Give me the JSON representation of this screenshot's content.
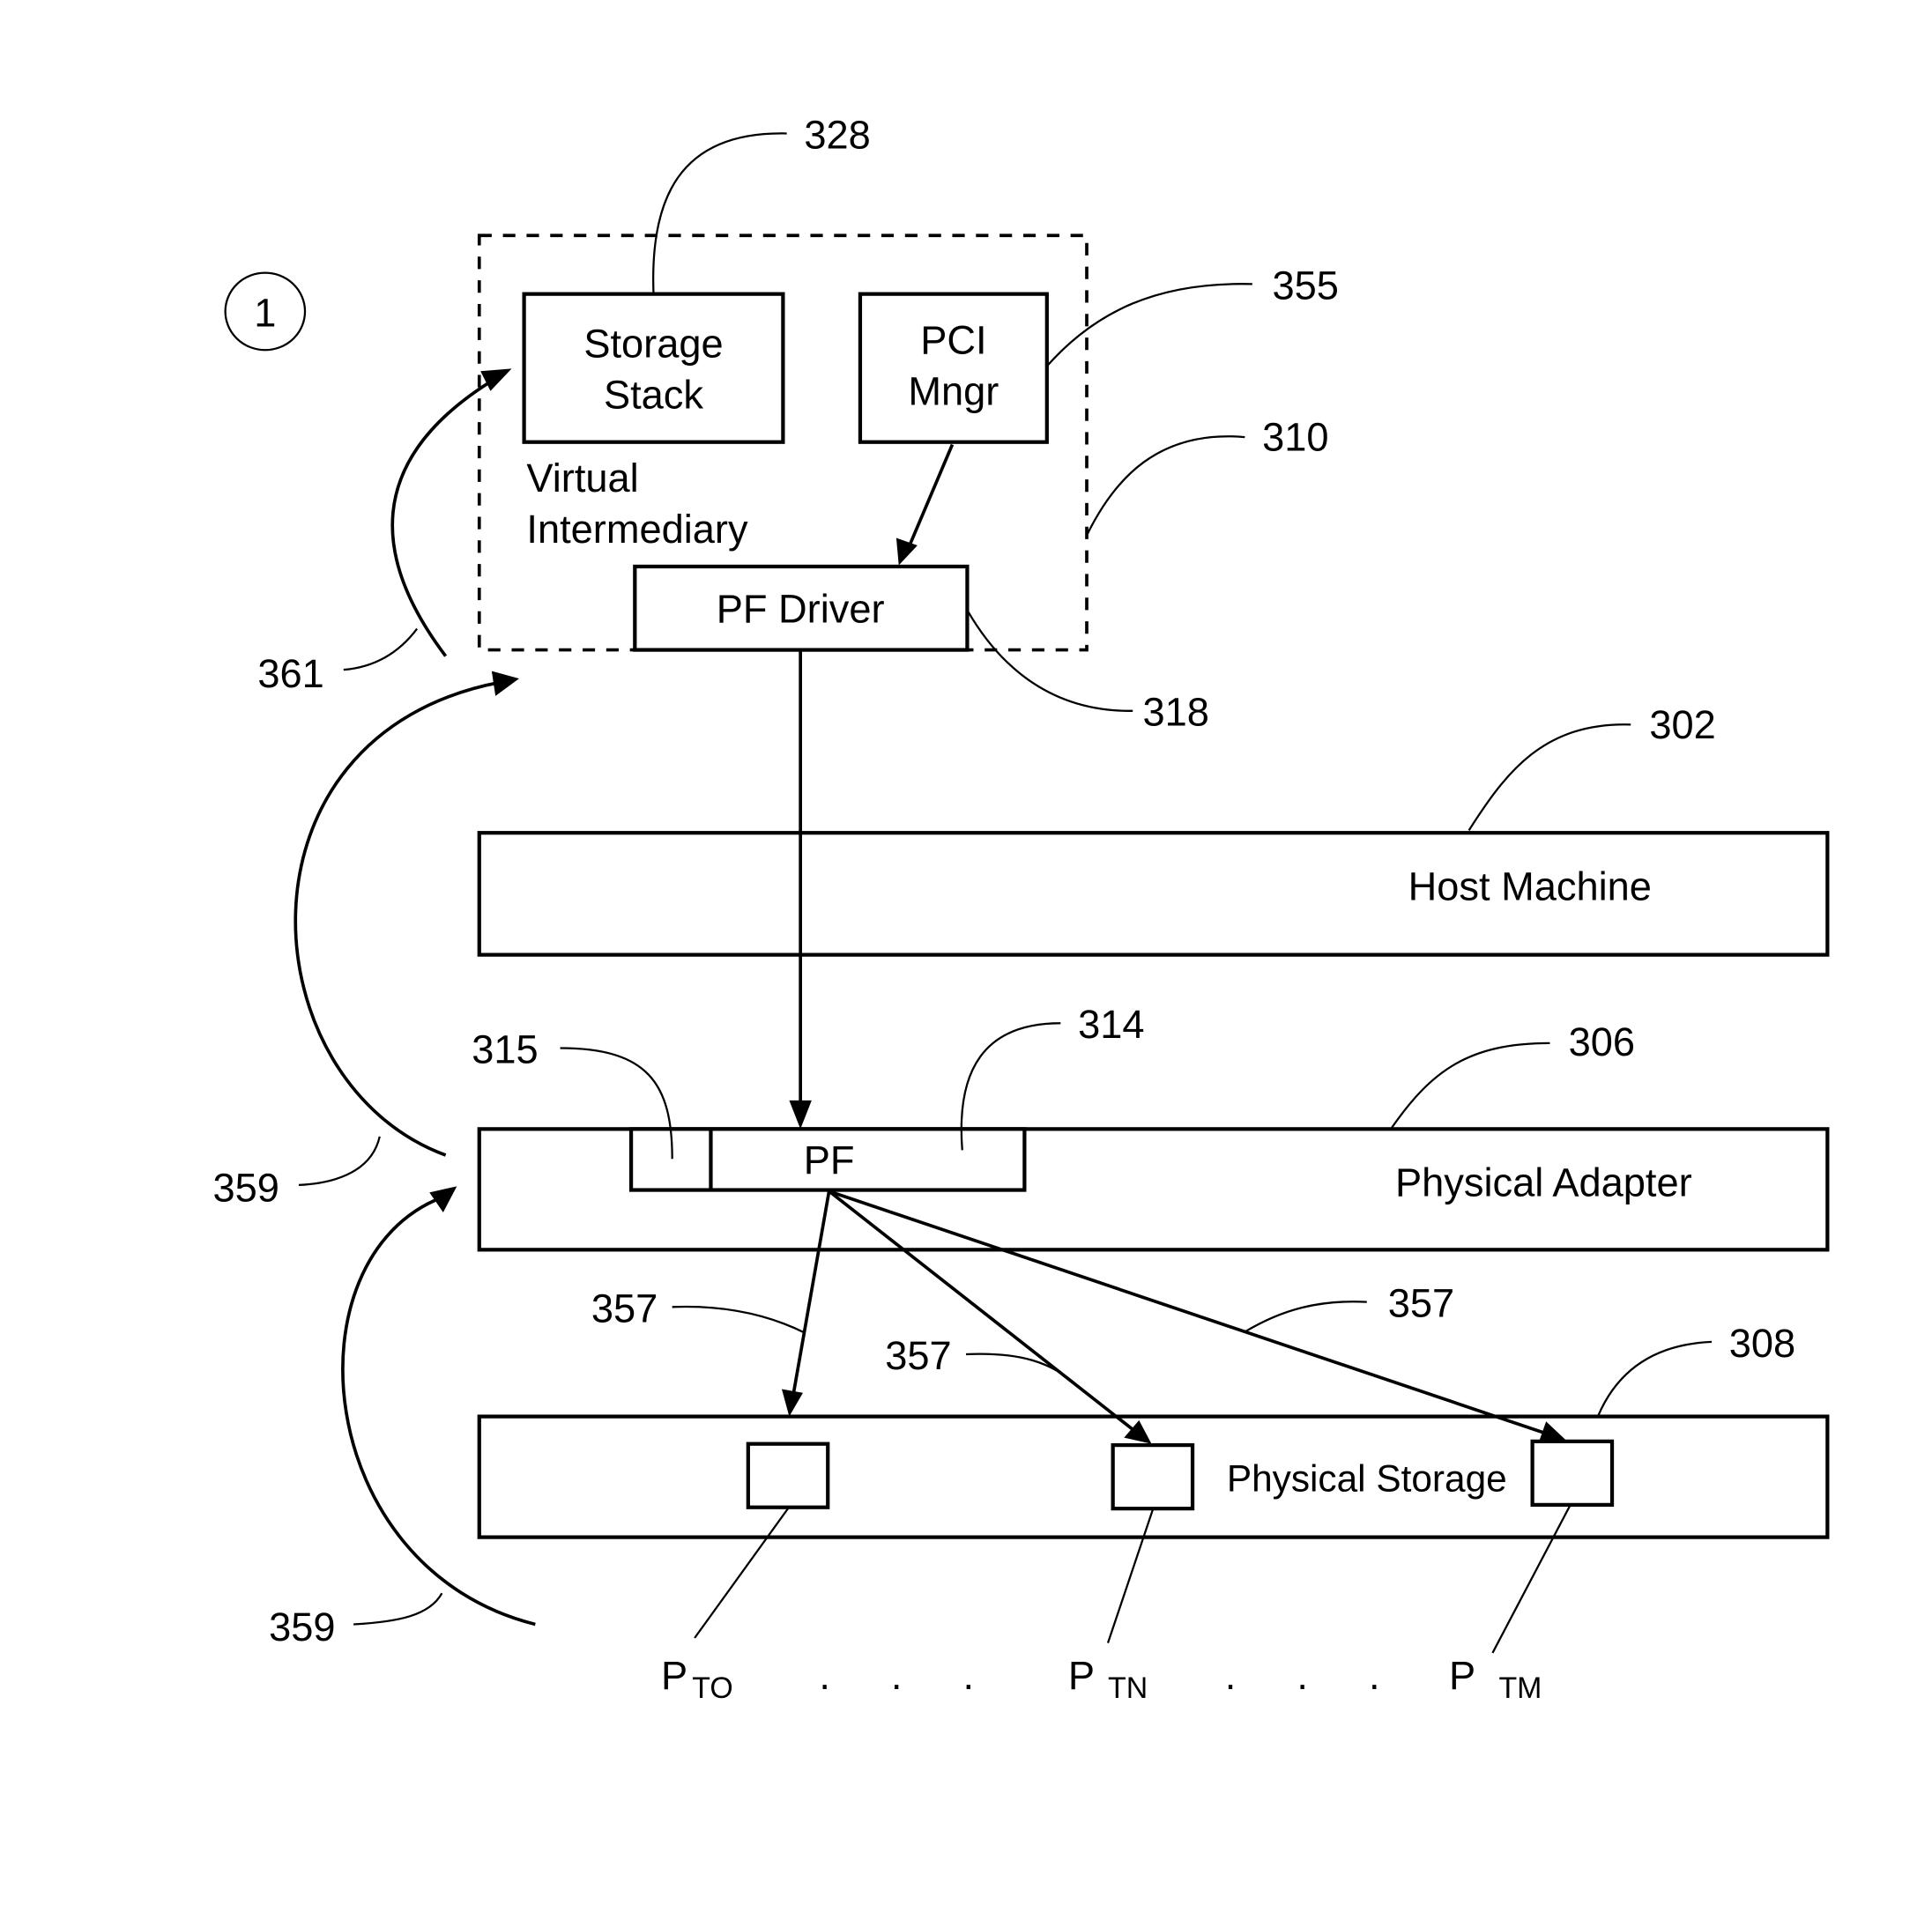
{
  "figure": {
    "circled_marker": "1",
    "virtual_intermediary": {
      "label_line1": "Virtual",
      "label_line2": "Intermediary",
      "ref": "310",
      "storage_stack": {
        "line1": "Storage",
        "line2": "Stack",
        "ref": "328"
      },
      "pci_manager": {
        "line1": "PCI",
        "line2": "Mngr",
        "ref": "355"
      },
      "pf_driver": {
        "label": "PF Driver",
        "ref": "318"
      }
    },
    "host_machine": {
      "label": "Host Machine",
      "ref": "302"
    },
    "physical_adapter": {
      "label": "Physical Adapter",
      "ref": "306",
      "pf": {
        "label": "PF",
        "ref": "314"
      },
      "pf_side_ref": "315"
    },
    "physical_storage": {
      "label": "Physical Storage",
      "ref": "308"
    },
    "path_refs": {
      "p1": "357",
      "p2": "357",
      "p3": "357"
    },
    "flow_refs": {
      "f361": "361",
      "f359a": "359",
      "f359b": "359"
    },
    "partitions": [
      {
        "main": "P",
        "sub": "TO"
      },
      {
        "main": "P",
        "sub": "TN"
      },
      {
        "main": "P",
        "sub": "TM"
      }
    ],
    "ellipsis": ". . ."
  }
}
